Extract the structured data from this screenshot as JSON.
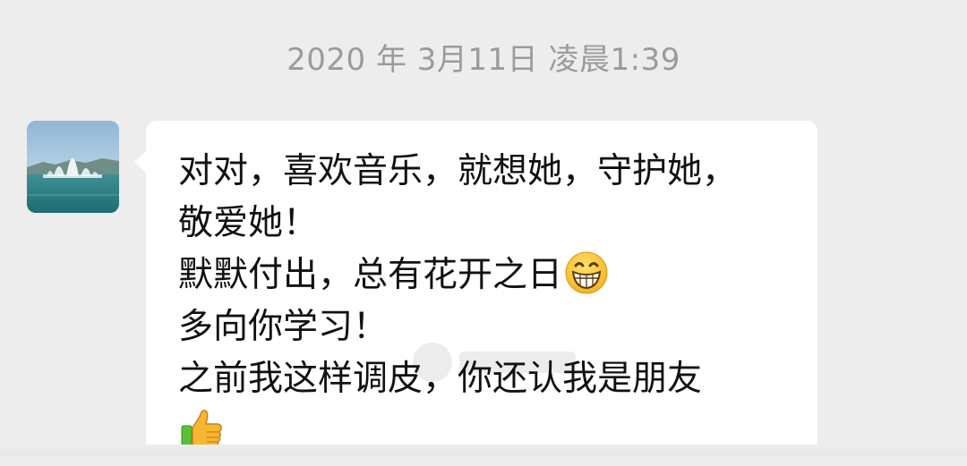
{
  "timestamp": "2020 年 3月11日 凌晨1:39",
  "message": {
    "lines": [
      "对对，喜欢音乐，就想她，守护她，",
      "敬爱她！",
      "默默付出，总有花开之日",
      "多向你学习！",
      "之前我这样调皮，你还认我是朋友",
      ""
    ],
    "inline_emojis": [
      "grin-emoji",
      "thumbs-up-emoji"
    ]
  },
  "colors": {
    "background": "#ededed",
    "bubble": "#ffffff",
    "text": "#111111",
    "timestamp": "#9b9b9b"
  }
}
